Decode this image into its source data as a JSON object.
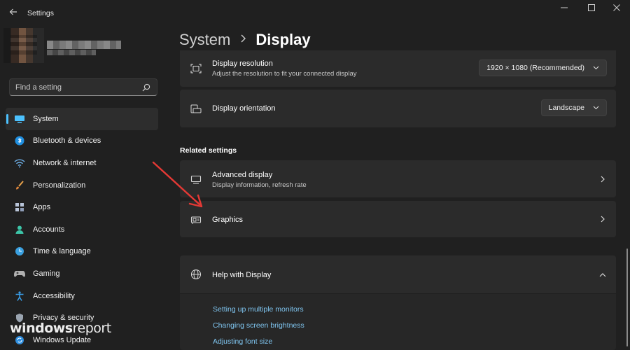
{
  "window": {
    "title": "Settings"
  },
  "search": {
    "placeholder": "Find a setting"
  },
  "nav": {
    "items": [
      {
        "label": "System",
        "icon": "monitor-icon",
        "selected": true
      },
      {
        "label": "Bluetooth & devices",
        "icon": "bluetooth-icon"
      },
      {
        "label": "Network & internet",
        "icon": "wifi-icon"
      },
      {
        "label": "Personalization",
        "icon": "brush-icon"
      },
      {
        "label": "Apps",
        "icon": "apps-grid-icon"
      },
      {
        "label": "Accounts",
        "icon": "person-icon"
      },
      {
        "label": "Time & language",
        "icon": "globe-clock-icon"
      },
      {
        "label": "Gaming",
        "icon": "gamepad-icon"
      },
      {
        "label": "Accessibility",
        "icon": "accessibility-icon"
      },
      {
        "label": "Privacy & security",
        "icon": "shield-icon"
      },
      {
        "label": "Windows Update",
        "icon": "update-icon"
      }
    ]
  },
  "breadcrumb": {
    "parent": "System",
    "current": "Display"
  },
  "settings": {
    "resolution": {
      "title": "Display resolution",
      "subtitle": "Adjust the resolution to fit your connected display",
      "value": "1920 × 1080 (Recommended)"
    },
    "orientation": {
      "title": "Display orientation",
      "value": "Landscape"
    }
  },
  "related": {
    "heading": "Related settings",
    "advanced": {
      "title": "Advanced display",
      "subtitle": "Display information, refresh rate"
    },
    "graphics": {
      "title": "Graphics"
    }
  },
  "help": {
    "title": "Help with Display",
    "links": [
      "Setting up multiple monitors",
      "Changing screen brightness",
      "Adjusting font size"
    ]
  },
  "watermark": {
    "part1": "windows",
    "part2": "report"
  },
  "colors": {
    "accent": "#4cc2ff",
    "background": "#202020",
    "card": "#2b2b2b",
    "link": "#7fc5f0",
    "annotation_arrow": "#e53935"
  }
}
